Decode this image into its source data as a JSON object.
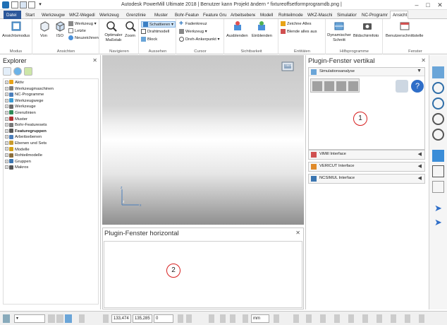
{
  "window": {
    "title": "Autodesk PowerMill Ultimate 2018  |  Benutzer kann Projekt ändern * fixtureoffsetformprogramdb.png  |"
  },
  "tabs": [
    "Datei",
    "Start",
    "Werkzeugweg",
    "WKZ-Wegedit",
    "Werkzeug",
    "Grenzlinie",
    "Muster",
    "Bohr-Feature",
    "Feature Grupp",
    "Arbeitsebene",
    "Modell",
    "Rohteilmodell",
    "WKZ-Maschin",
    "Simulation",
    "NC-Programme",
    "Ansicht"
  ],
  "ribbon": {
    "modus": {
      "button": "Ansichtsmodus",
      "label": "Modus"
    },
    "ansichten": {
      "von": "Von",
      "iso": "ISO",
      "werkzeug": "Werkzeug",
      "letzte": "Letzte",
      "neuzeichnen": "Neuzeichnen",
      "label": "Ansichten"
    },
    "navigieren": {
      "optimaler": "Optimaler Maßstab",
      "zoom": "Zoom",
      "label": "Navigieren"
    },
    "aussehen": {
      "schattieren": "Schattieren",
      "drahtmodell": "Drahtmodell",
      "block": "Block",
      "label": "Aussehen"
    },
    "cursor": {
      "fadenkreuz": "Fadenkreuz",
      "werkzeug": "Werkzeug",
      "dreh": "Dreh-Ankerpunkt",
      "label": "Cursor"
    },
    "sichtbarkeit": {
      "ausblenden": "Ausblenden",
      "einblenden": "Einblenden",
      "label": "Sichtbarkeit"
    },
    "entitaeten": {
      "zeichne": "Zeichne Alles",
      "blende": "Blende alles aus",
      "label": "Entitäten"
    },
    "hilfsprogramme": {
      "dyn": "Dynamischer Schnitt",
      "bild": "Bildschirmfoto",
      "label": "Hilfsprogramme"
    },
    "fenster": {
      "benutzer": "Benutzerschnittstelle",
      "label": "Fenster"
    }
  },
  "explorer": {
    "title": "Explorer",
    "items": [
      {
        "label": "Aktiv",
        "color": "#e8a317",
        "bold": false
      },
      {
        "label": "Werkzeugmaschinen",
        "color": "#7d7d7d",
        "bold": false
      },
      {
        "label": "NC-Programme",
        "color": "#4a7ebb",
        "bold": false
      },
      {
        "label": "Werkzeugwege",
        "color": "#3a9bd5",
        "bold": false
      },
      {
        "label": "Werkzeuge",
        "color": "#6a6a6a",
        "bold": false
      },
      {
        "label": "Grenzlinien",
        "color": "#2e8b57",
        "bold": false
      },
      {
        "label": "Muster",
        "color": "#b03030",
        "bold": false
      },
      {
        "label": "Bohr-Featuresets",
        "color": "#777777",
        "bold": false
      },
      {
        "label": "Featuregruppen",
        "color": "#555555",
        "bold": true
      },
      {
        "label": "Arbeitsebenen",
        "color": "#4a7ebb",
        "bold": false
      },
      {
        "label": "Ebenen und Sets",
        "color": "#c89b2e",
        "bold": false
      },
      {
        "label": "Modelle",
        "color": "#d4a017",
        "bold": false
      },
      {
        "label": "Rohteilmodelle",
        "color": "#8a6d3b",
        "bold": false
      },
      {
        "label": "Gruppen",
        "color": "#3a75b0",
        "bold": false
      },
      {
        "label": "Makros",
        "color": "#555555",
        "bold": false
      }
    ]
  },
  "viewport": {
    "viewcube_label": "OBEN"
  },
  "hplugin": {
    "title": "Plugin-Fenster horizontal",
    "marker": "2"
  },
  "vplugin": {
    "title": "Plugin-Fenster vertikal",
    "simulation": "Simulationsanalyse",
    "marker": "1",
    "panels": [
      "ViMill Interface",
      "VERICUT Interface",
      "NCSIMUL Interface"
    ]
  },
  "status": {
    "x": "133,474",
    "y": "135,285",
    "z": "0",
    "unit": "mm"
  },
  "colors": {
    "accent": "#2b579a",
    "marker": "#d62020"
  }
}
